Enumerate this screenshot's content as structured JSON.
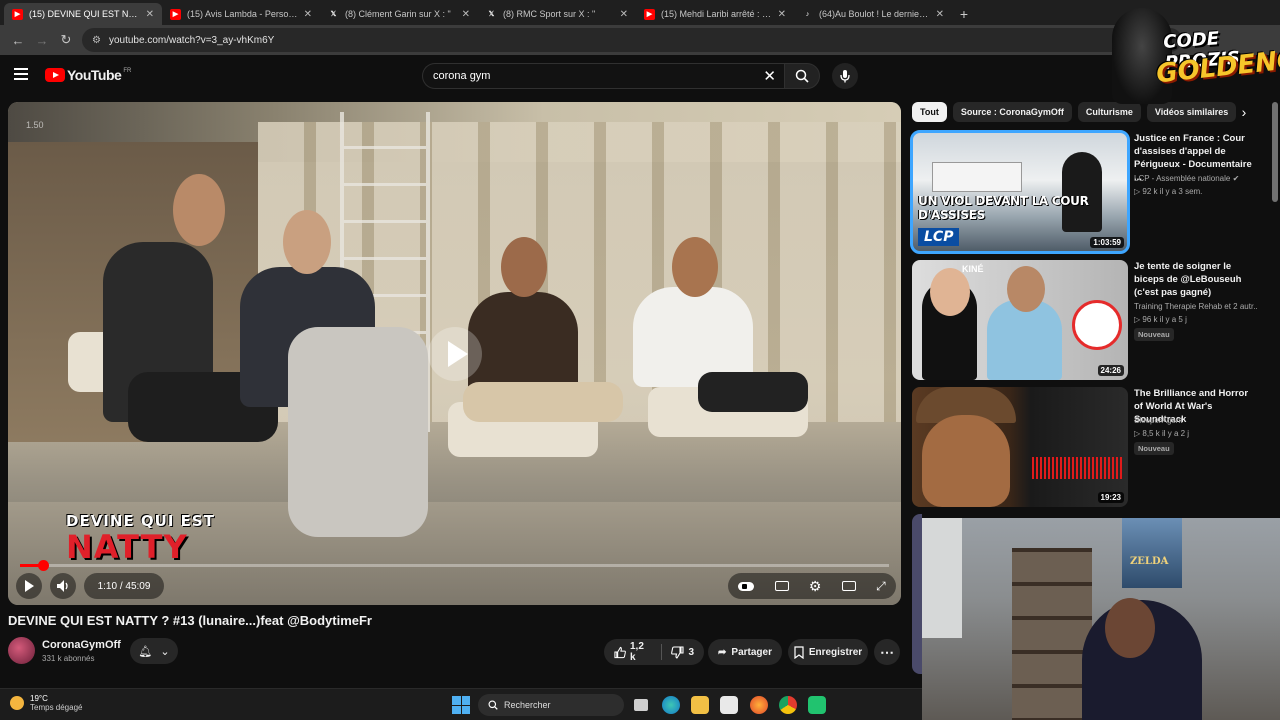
{
  "browser": {
    "tabs": [
      {
        "title": "(15) DEVINE QUI EST NATTY ? #",
        "icon": "youtube-icon",
        "color": "#ff0000",
        "active": true
      },
      {
        "title": "(15) Avis Lambda - Persona 5 R",
        "icon": "youtube-icon",
        "color": "#ff0000",
        "active": false
      },
      {
        "title": "(8) Clément Garin sur X : \"",
        "icon": "x-icon",
        "color": "#ffffff",
        "active": false
      },
      {
        "title": "(8) RMC Sport sur X : \"",
        "icon": "x-icon",
        "color": "#ffffff",
        "active": false
      },
      {
        "title": "(15) Mehdi Laribi arrêté : \"La D",
        "icon": "youtube-icon",
        "color": "#ff0000",
        "active": false
      },
      {
        "title": "(64)Au Boulot ! Le dernier film",
        "icon": "tiktok-icon",
        "color": "#ffffff",
        "active": false
      }
    ],
    "close_glyph": "✕",
    "new_tab_glyph": "+",
    "url": "youtube.com/watch?v=3_ay-vhKm6Y"
  },
  "youtube": {
    "logo_text": "YouTube",
    "logo_region": "FR",
    "search_value": "corona gym",
    "clear_glyph": "✕"
  },
  "player": {
    "speed_label": "1.50",
    "overlay_line1": "DEVINE QUI EST",
    "overlay_line2": "NATTY",
    "time": "1:10 / 45:09",
    "progress_fraction": 0.026
  },
  "video": {
    "title": "DEVINE QUI EST NATTY ? #13 (lunaire...)feat @BodytimeFr",
    "channel": "CoronaGymOff",
    "subscribers": "331 k abonnés",
    "likes": "1,2 k",
    "dislikes": "3",
    "share_label": "Partager",
    "save_label": "Enregistrer"
  },
  "chips": [
    "Tout",
    "Source : CoronaGymOff",
    "Culturisme",
    "Vidéos similaires"
  ],
  "recommendations": [
    {
      "title": "Justice en France : Cour d'assises d'appel de Périgueux - Documentaire ...",
      "channel": "LCP - Assemblée nationale",
      "meta": "▷ 92 k  il y a 3 sem.",
      "duration": "1:03:59",
      "caption": "UN VIOL DEVANT LA COUR D'ASSISES",
      "logo": "LCP",
      "badge": ""
    },
    {
      "title": "Je tente de soigner le biceps de @LeBouseuh (c'est pas gagné)",
      "channel": "Training Therapie Rehab et 2 autr...",
      "meta": "▷ 96 k  il y a 5 j",
      "duration": "24:26",
      "caption": "KINÉ",
      "logo": "",
      "badge": "Nouveau"
    },
    {
      "title": "The Brilliance and Horror of World At War's Soundtrack",
      "channel": "SleeperAgent",
      "meta": "▷ 8,5 k  il y a 2 j",
      "duration": "19:23",
      "caption": "",
      "logo": "",
      "badge": "Nouveau"
    }
  ],
  "overlay_logo": {
    "line1": "CODE PROZIS",
    "line2": "GOLDENG"
  },
  "webcam": {
    "poster_text": "ZELDA"
  },
  "taskbar": {
    "temperature": "19°C",
    "condition": "Temps dégagé",
    "search_placeholder": "Rechercher"
  },
  "colors": {
    "accent": "#ff0000",
    "link": "#3ea6ff",
    "background": "#0f0f0f"
  }
}
